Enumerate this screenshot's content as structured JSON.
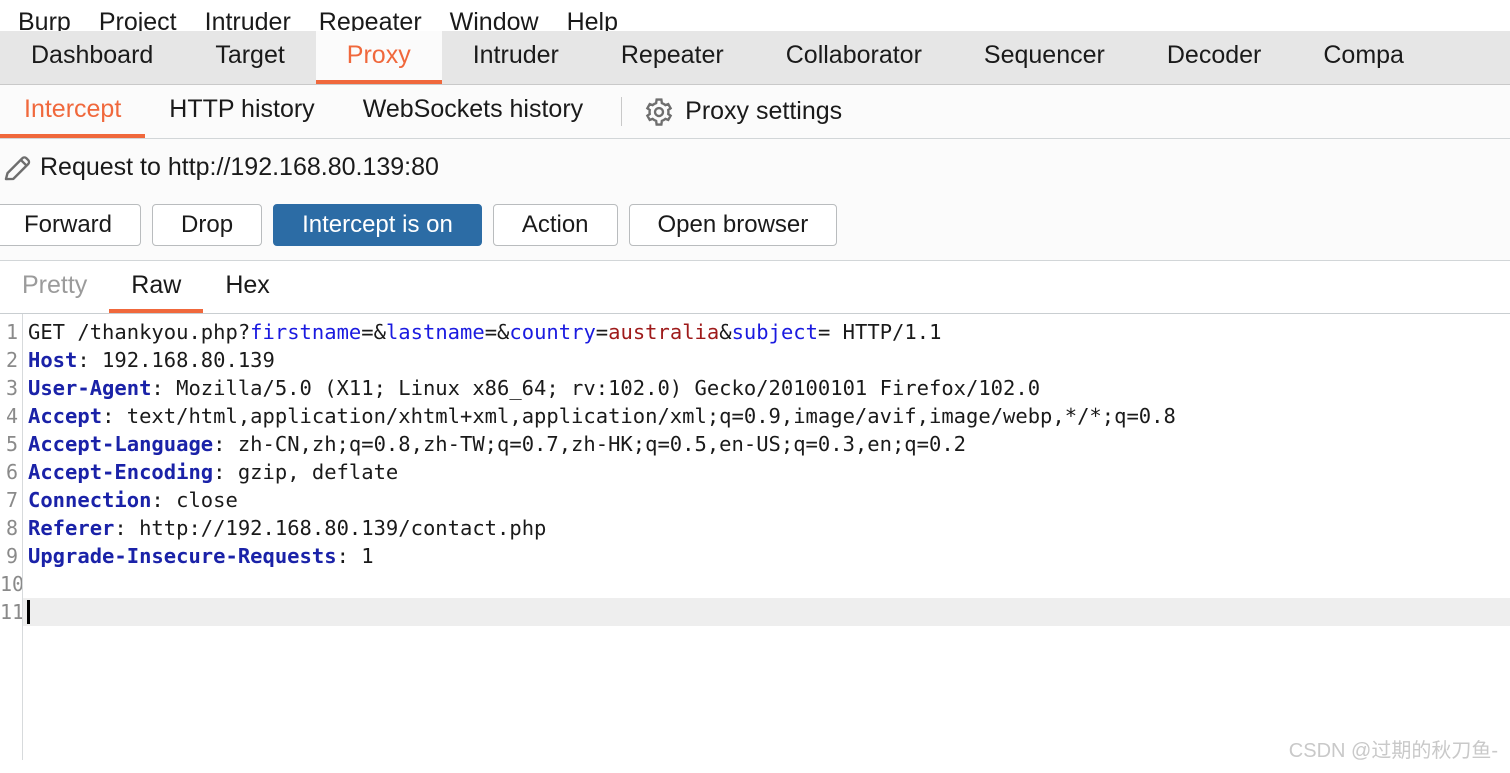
{
  "menubar": {
    "items": [
      {
        "label": "Burp"
      },
      {
        "label": "Project"
      },
      {
        "label": "Intruder"
      },
      {
        "label": "Repeater"
      },
      {
        "label": "Window"
      },
      {
        "label": "Help"
      }
    ]
  },
  "tabstrip": {
    "tabs": [
      {
        "label": "Dashboard",
        "active": false
      },
      {
        "label": "Target",
        "active": false
      },
      {
        "label": "Proxy",
        "active": true
      },
      {
        "label": "Intruder",
        "active": false
      },
      {
        "label": "Repeater",
        "active": false
      },
      {
        "label": "Collaborator",
        "active": false
      },
      {
        "label": "Sequencer",
        "active": false
      },
      {
        "label": "Decoder",
        "active": false
      },
      {
        "label": "Compa",
        "active": false
      }
    ]
  },
  "subtabs": {
    "tabs": [
      {
        "label": "Intercept",
        "active": true
      },
      {
        "label": "HTTP history",
        "active": false
      },
      {
        "label": "WebSockets history",
        "active": false
      }
    ],
    "proxy_settings_label": "Proxy settings"
  },
  "request": {
    "title": "Request to http://192.168.80.139:80",
    "buttons": [
      {
        "label": "Forward",
        "primary": false
      },
      {
        "label": "Drop",
        "primary": false
      },
      {
        "label": "Intercept is on",
        "primary": true
      },
      {
        "label": "Action",
        "primary": false
      },
      {
        "label": "Open browser",
        "primary": false
      }
    ]
  },
  "viewtabs": {
    "tabs": [
      {
        "label": "Pretty",
        "active": false,
        "muted": true
      },
      {
        "label": "Raw",
        "active": true,
        "muted": false
      },
      {
        "label": "Hex",
        "active": false,
        "muted": false
      }
    ]
  },
  "editor": {
    "line_numbers": [
      "1",
      "2",
      "3",
      "4",
      "5",
      "6",
      "7",
      "8",
      "9",
      "10",
      "11"
    ],
    "lines": [
      {
        "number": "1",
        "current": false,
        "tokens": [
          {
            "t": "GET /thankyou.php?",
            "c": "plain"
          },
          {
            "t": "firstname",
            "c": "pname"
          },
          {
            "t": "=&",
            "c": "plain"
          },
          {
            "t": "lastname",
            "c": "pname"
          },
          {
            "t": "=&",
            "c": "plain"
          },
          {
            "t": "country",
            "c": "pname"
          },
          {
            "t": "=",
            "c": "plain"
          },
          {
            "t": "australia",
            "c": "pval"
          },
          {
            "t": "&",
            "c": "plain"
          },
          {
            "t": "subject",
            "c": "pname"
          },
          {
            "t": "= HTTP/1.1",
            "c": "plain"
          }
        ]
      },
      {
        "number": "2",
        "current": false,
        "tokens": [
          {
            "t": "Host",
            "c": "hdr"
          },
          {
            "t": ": 192.168.80.139",
            "c": "plain"
          }
        ]
      },
      {
        "number": "3",
        "current": false,
        "tokens": [
          {
            "t": "User-Agent",
            "c": "hdr"
          },
          {
            "t": ": Mozilla/5.0 (X11; Linux x86_64; rv:102.0) Gecko/20100101 Firefox/102.0",
            "c": "plain"
          }
        ]
      },
      {
        "number": "4",
        "current": false,
        "tokens": [
          {
            "t": "Accept",
            "c": "hdr"
          },
          {
            "t": ": text/html,application/xhtml+xml,application/xml;q=0.9,image/avif,image/webp,*/*;q=0.8",
            "c": "plain"
          }
        ]
      },
      {
        "number": "5",
        "current": false,
        "tokens": [
          {
            "t": "Accept-Language",
            "c": "hdr"
          },
          {
            "t": ": zh-CN,zh;q=0.8,zh-TW;q=0.7,zh-HK;q=0.5,en-US;q=0.3,en;q=0.2",
            "c": "plain"
          }
        ]
      },
      {
        "number": "6",
        "current": false,
        "tokens": [
          {
            "t": "Accept-Encoding",
            "c": "hdr"
          },
          {
            "t": ": gzip, deflate",
            "c": "plain"
          }
        ]
      },
      {
        "number": "7",
        "current": false,
        "tokens": [
          {
            "t": "Connection",
            "c": "hdr"
          },
          {
            "t": ": close",
            "c": "plain"
          }
        ]
      },
      {
        "number": "8",
        "current": false,
        "tokens": [
          {
            "t": "Referer",
            "c": "hdr"
          },
          {
            "t": ": http://192.168.80.139/contact.php",
            "c": "plain"
          }
        ]
      },
      {
        "number": "9",
        "current": false,
        "tokens": [
          {
            "t": "Upgrade-Insecure-Requests",
            "c": "hdr"
          },
          {
            "t": ": 1",
            "c": "plain"
          }
        ]
      },
      {
        "number": "10",
        "current": false,
        "tokens": []
      },
      {
        "number": "11",
        "current": true,
        "tokens": []
      }
    ]
  },
  "watermark": {
    "text": "CSDN @过期的秋刀鱼-"
  },
  "colors": {
    "accent_orange": "#f0683c",
    "primary_button_blue": "#2c6ca5",
    "tabstrip_grey": "#e6e6e6",
    "header_blue": "#1a22a8",
    "param_blue": "#1a1ae0",
    "param_value_red": "#9e1a1a",
    "current_line": "#eeeeee"
  }
}
